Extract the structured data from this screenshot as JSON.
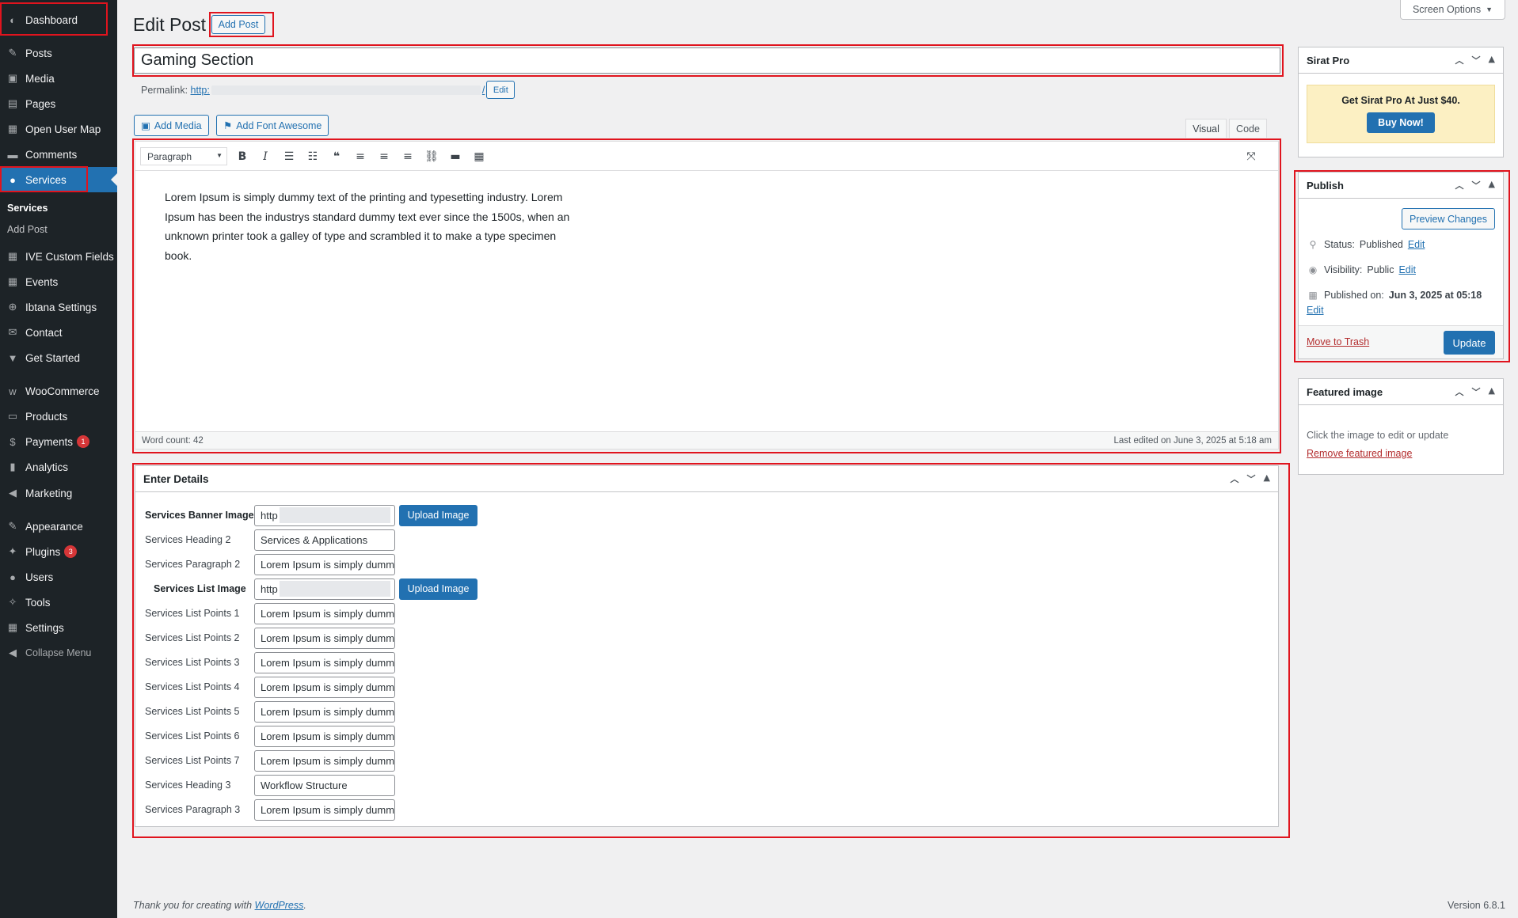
{
  "sidebar": {
    "items": [
      {
        "label": "Dashboard",
        "icon": "dashboard-icon",
        "glyph": "◐"
      },
      {
        "label": "Posts",
        "icon": "pin-icon",
        "glyph": "✎"
      },
      {
        "label": "Media",
        "icon": "media-icon",
        "glyph": "▣"
      },
      {
        "label": "Pages",
        "icon": "pages-icon",
        "glyph": "▤"
      },
      {
        "label": "Open User Map",
        "icon": "map-icon",
        "glyph": "▦"
      },
      {
        "label": "Comments",
        "icon": "comment-icon",
        "glyph": "▬"
      },
      {
        "label": "Services",
        "icon": "user-icon",
        "glyph": "●"
      },
      {
        "label": "IVE Custom Fields",
        "icon": "grid-icon",
        "glyph": "▦"
      },
      {
        "label": "Events",
        "icon": "calendar-icon",
        "glyph": "▦"
      },
      {
        "label": "Ibtana Settings",
        "icon": "ibtana-icon",
        "glyph": "⊕"
      },
      {
        "label": "Contact",
        "icon": "mail-icon",
        "glyph": "✉"
      },
      {
        "label": "Get Started",
        "icon": "chevron-icon",
        "glyph": "▼"
      },
      {
        "label": "WooCommerce",
        "icon": "woo-icon",
        "glyph": "w"
      },
      {
        "label": "Products",
        "icon": "archive-icon",
        "glyph": "▭"
      },
      {
        "label": "Payments",
        "icon": "dollar-icon",
        "glyph": "$",
        "badge": "1"
      },
      {
        "label": "Analytics",
        "icon": "bar-chart-icon",
        "glyph": "▮"
      },
      {
        "label": "Marketing",
        "icon": "megaphone-icon",
        "glyph": "◀"
      },
      {
        "label": "Appearance",
        "icon": "brush-icon",
        "glyph": "✎"
      },
      {
        "label": "Plugins",
        "icon": "plugin-icon",
        "glyph": "✦",
        "badge": "3"
      },
      {
        "label": "Users",
        "icon": "users-icon",
        "glyph": "●"
      },
      {
        "label": "Tools",
        "icon": "wrench-icon",
        "glyph": "✧"
      },
      {
        "label": "Settings",
        "icon": "settings-icon",
        "glyph": "▦"
      },
      {
        "label": "Collapse Menu",
        "icon": "collapse-icon",
        "glyph": "◀"
      }
    ],
    "submenu": [
      "Services",
      "Add Post"
    ]
  },
  "header": {
    "title": "Edit Post",
    "add_post": "Add Post",
    "screen_options": "Screen Options"
  },
  "post": {
    "title": "Gaming Section",
    "permalink_label": "Permalink:",
    "permalink_prefix": "http:",
    "permalink_suffix": "/",
    "permalink_edit": "Edit"
  },
  "editor": {
    "add_media": "Add Media",
    "add_font_awesome": "Add Font Awesome",
    "tab_visual": "Visual",
    "tab_code": "Code",
    "format": "Paragraph",
    "content": "Lorem Ipsum is simply dummy text of the printing and typesetting industry. Lorem Ipsum has been the industrys standard dummy text ever since the 1500s, when an unknown printer took a galley of type and scrambled it to make a type specimen book.",
    "word_count": "Word count: 42",
    "last_edited": "Last edited on June 3, 2025 at 5:18 am"
  },
  "details": {
    "title": "Enter Details",
    "upload_label": "Upload Image",
    "fields": [
      {
        "label": "Services Banner Image",
        "value": "http",
        "bold": true,
        "upload": true
      },
      {
        "label": "Services Heading 2",
        "value": "Services & Applications"
      },
      {
        "label": "Services Paragraph 2",
        "value": "Lorem Ipsum is simply dummy"
      },
      {
        "label": "Services List Image",
        "value": "http",
        "bold": true,
        "upload": true
      },
      {
        "label": "Services List Points 1",
        "value": "Lorem Ipsum is simply dummy"
      },
      {
        "label": "Services List Points 2",
        "value": "Lorem Ipsum is simply dummy"
      },
      {
        "label": "Services List Points 3",
        "value": "Lorem Ipsum is simply dummy"
      },
      {
        "label": "Services List Points 4",
        "value": "Lorem Ipsum is simply dummy"
      },
      {
        "label": "Services List Points 5",
        "value": "Lorem Ipsum is simply dummy"
      },
      {
        "label": "Services List Points 6",
        "value": "Lorem Ipsum is simply dummy"
      },
      {
        "label": "Services List Points 7",
        "value": "Lorem Ipsum is simply dummy"
      },
      {
        "label": "Services Heading 3",
        "value": "Workflow Structure"
      },
      {
        "label": "Services Paragraph 3",
        "value": "Lorem Ipsum is simply dummy"
      }
    ]
  },
  "sirat": {
    "title": "Sirat Pro",
    "promo": "Get Sirat Pro At Just $40.",
    "buy": "Buy Now!"
  },
  "publish": {
    "title": "Publish",
    "preview": "Preview Changes",
    "status_label": "Status:",
    "status_value": "Published",
    "visibility_label": "Visibility:",
    "visibility_value": "Public",
    "published_label": "Published on:",
    "published_value": "Jun 3, 2025 at 05:18",
    "edit": "Edit",
    "trash": "Move to Trash",
    "update": "Update"
  },
  "featured": {
    "title": "Featured image",
    "hint": "Click the image to edit or update",
    "remove": "Remove featured image"
  },
  "footer": {
    "thanks": "Thank you for creating with ",
    "wp": "WordPress",
    "period": ".",
    "version": "Version 6.8.1"
  },
  "colors": {
    "accent": "#2271b1",
    "sidebar": "#1d2327",
    "highlight": "#e0141e"
  }
}
